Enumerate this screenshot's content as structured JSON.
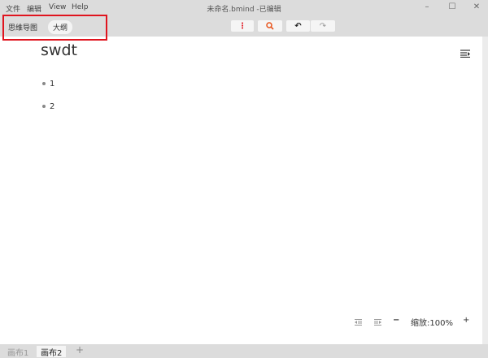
{
  "menu": [
    "文件",
    "编辑",
    "View",
    "Help"
  ],
  "window": {
    "title": "未命名.bmind -已编辑",
    "minimize": "–",
    "maximize": "☐",
    "close": "✕"
  },
  "modes": {
    "mindmap": "思维导图",
    "outline": "大纲"
  },
  "toolbar": {
    "more_icon": "⋮",
    "search_icon": "🔍",
    "undo_icon": "↶",
    "redo_icon": "↷"
  },
  "document": {
    "root": "swdt",
    "items": [
      "1",
      "2"
    ]
  },
  "zoom": {
    "label": "缩放:100%",
    "minus": "−",
    "plus": "+"
  },
  "sheets": {
    "tabs": [
      "画布1",
      "画布2"
    ],
    "active": 1,
    "add": "+"
  },
  "colors": {
    "accent": "#e8541c",
    "highlight": "#e0141e",
    "more": "#e0141e"
  }
}
